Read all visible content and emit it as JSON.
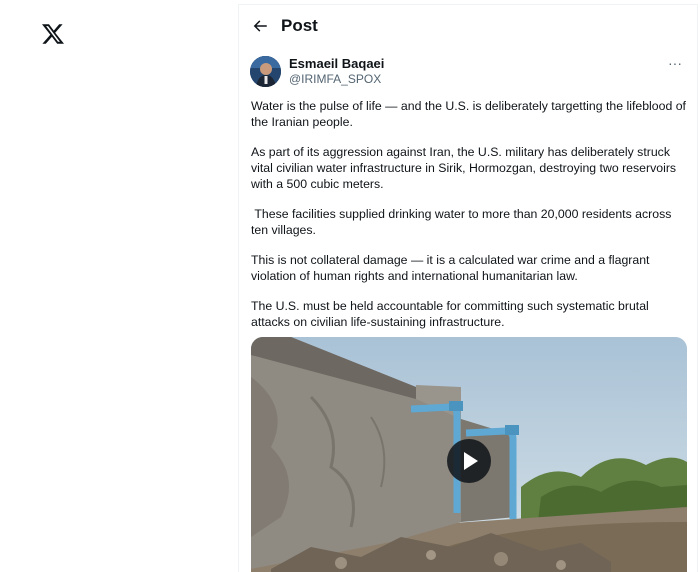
{
  "app": {
    "logo_icon": "x-logo-icon"
  },
  "header": {
    "back_icon": "arrow-left-icon",
    "title": "Post"
  },
  "post": {
    "author_name": "Esmaeil Baqaei",
    "author_handle": "@IRIMFA_SPOX",
    "more_icon": "more-horizontal-icon",
    "more_glyph": "···",
    "paragraphs": [
      "Water is the pulse of life — and the U.S. is deliberately targetting the lifeblood of the Iranian people.",
      "As part of its aggression against Iran, the U.S. military has deliberately struck vital civilian water infrastructure in Sirik, Hormozgan, destroying two reservoirs with a 500 cubic meters.",
      " These facilities supplied drinking water to more than 20,000 residents across ten villages.",
      "This is not collateral damage — it is a calculated war crime and a flagrant violation of human rights and international humanitarian law.",
      "The U.S. must be held accountable for committing such systematic brutal attacks on civilian life-sustaining infrastructure."
    ],
    "media": {
      "type": "video",
      "play_icon": "play-icon"
    }
  },
  "colors": {
    "text": "#0f1419",
    "secondary": "#536471",
    "border": "#eff3f4",
    "pipe": "#5fa8d3"
  }
}
